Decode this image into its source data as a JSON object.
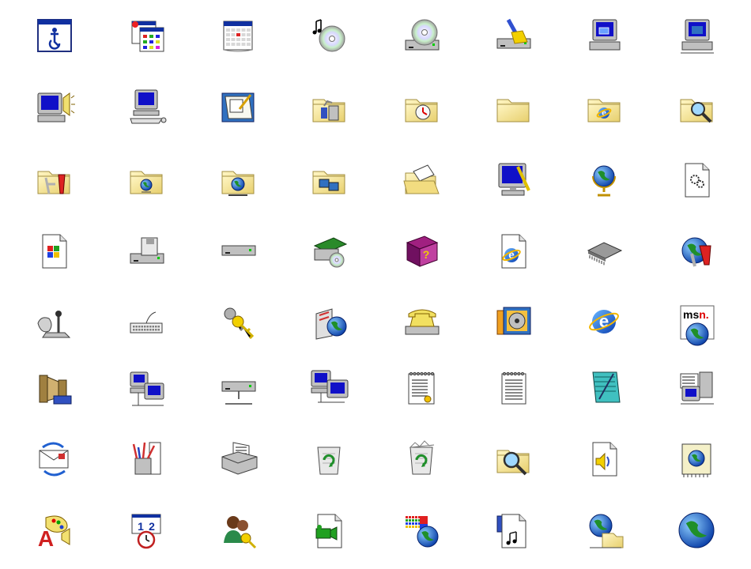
{
  "window": {
    "background": "#ffffff"
  },
  "text": {
    "clock_digits": [
      "1",
      "2"
    ],
    "msn_logo_prefix": "ms",
    "msn_logo_suffix": "n."
  },
  "icons": [
    [
      "accessibility-icon",
      "windows-update-icon",
      "calendar-icon",
      "cd-audio-icon",
      "cd-drive-icon",
      "disk-cleanup-icon",
      "my-computer-icon",
      "network-computer-icon"
    ],
    [
      "multimedia-monitor-icon",
      "computer-keyboard-icon",
      "notepad-icon",
      "control-panel-folder-icon",
      "scheduled-tasks-folder-icon",
      "folder-icon",
      "internet-folder-icon",
      "search-folder-icon"
    ],
    [
      "admin-tools-folder-icon",
      "network-places-folder-icon",
      "shared-globe-folder-icon",
      "network-folder-icon",
      "open-folder-icon",
      "display-settings-icon",
      "globe-stand-icon",
      "settings-file-icon"
    ],
    [
      "windows-logo-file-icon",
      "floppy-drive-icon",
      "hard-drive-icon",
      "hardware-card-icon",
      "help-book-icon",
      "internet-shortcut-icon",
      "memory-chip-icon",
      "network-tools-icon"
    ],
    [
      "game-controller-icon",
      "keyboard-icon",
      "keys-icon",
      "mail-globe-icon",
      "modem-phone-icon",
      "media-reel-icon",
      "internet-explorer-icon",
      "msn-icon"
    ],
    [
      "multimedia-film-icon",
      "network-computers-icon",
      "network-drive-icon",
      "connected-computers-icon",
      "spiral-document-icon",
      "text-document-icon",
      "note-pad-icon",
      "server-network-icon"
    ],
    [
      "outlook-sync-icon",
      "pen-holder-icon",
      "printer-icon",
      "recycle-bin-empty-icon",
      "recycle-bin-full-icon",
      "search-folder-magnify-icon",
      "sound-file-icon",
      "web-page-file-icon"
    ],
    [
      "fonts-paint-icon",
      "clock-calendar-icon",
      "user-keys-icon",
      "video-file-icon",
      "windows-globe-icon",
      "media-player-file-icon",
      "network-world-icon",
      "globe-icon"
    ]
  ],
  "colors": {
    "folder": "#f6e79c",
    "folder_edge": "#a38f42",
    "screen_blue": "#1010c8",
    "case_gray": "#c0c0c0",
    "globe_green": "#1f8f2a",
    "globe_blue": "#1050c8"
  }
}
